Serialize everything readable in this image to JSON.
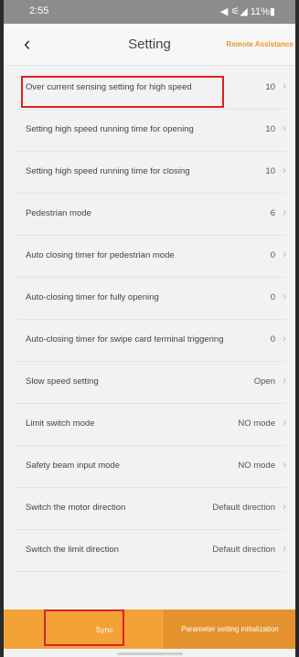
{
  "status": {
    "time": "2:55",
    "icons": "◀ ⚟◢ 11%▮"
  },
  "header": {
    "back": "‹",
    "title": "Setting",
    "remote": "Remote Assistance"
  },
  "rows": [
    {
      "label": "Over current sensing setting for high speed",
      "value": "10"
    },
    {
      "label": "Setting high speed running time for opening",
      "value": "10"
    },
    {
      "label": "Setting high speed running time for closing",
      "value": "10"
    },
    {
      "label": "Pedestrian mode",
      "value": "6"
    },
    {
      "label": "Auto closing timer for pedestrian mode",
      "value": "0"
    },
    {
      "label": "Auto-closing timer for fully opening",
      "value": "0"
    },
    {
      "label": "Auto-closing timer for swipe card terminal triggering",
      "value": "0"
    },
    {
      "label": "Slow speed setting",
      "value": "Open"
    },
    {
      "label": "Limit switch mode",
      "value": "NO mode"
    },
    {
      "label": "Safety beam input mode",
      "value": "NO mode"
    },
    {
      "label": "Switch the motor direction",
      "value": "Default direction"
    },
    {
      "label": "Switch the limit direction",
      "value": "Default direction"
    }
  ],
  "chevron": "›",
  "bottom": {
    "sync": "Sync",
    "init": "Parameter setting initialization"
  }
}
